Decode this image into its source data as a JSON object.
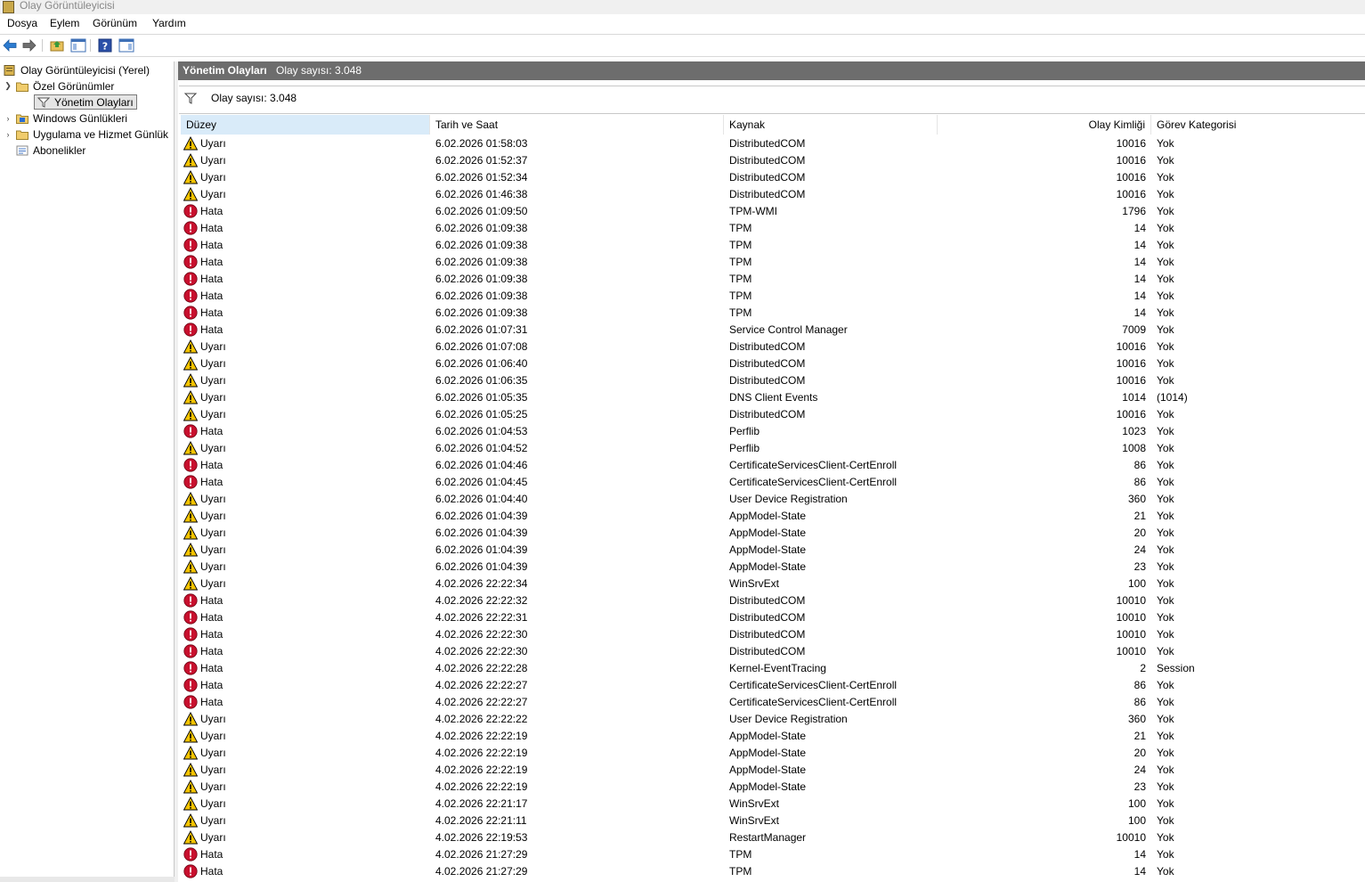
{
  "window": {
    "title": "Olay Görüntüleyicisi"
  },
  "menu": [
    "Dosya",
    "Eylem",
    "Görünüm",
    "Yardım"
  ],
  "toolbar": [
    "back-arrow-icon",
    "forward-arrow-icon",
    "open-folder-icon",
    "console-tree-icon",
    "help-icon",
    "action-pane-icon"
  ],
  "sidebar": {
    "root": "Olay Görüntüleyicisi (Yerel)",
    "custom_views": "Özel Görünümler",
    "admin_events": "Yönetim Olayları",
    "windows_logs": "Windows Günlükleri",
    "app_service_logs": "Uygulama ve Hizmet Günlük",
    "subscriptions": "Abonelikler"
  },
  "main": {
    "title": "Yönetim Olayları",
    "count_header": "Olay sayısı: 3.048",
    "filter_count": "Olay sayısı: 3.048",
    "columns": [
      "Düzey",
      "Tarih ve Saat",
      "Kaynak",
      "Olay Kimliği",
      "Görev Kategorisi"
    ]
  },
  "colors": {
    "header_bg": "#6d6d6d",
    "selected_col": "#d9ebf9",
    "warning": "#f5c400",
    "error": "#c8102e"
  },
  "events": [
    [
      "Uyarı",
      "6.02.2026 01:58:03",
      "DistributedCOM",
      "10016",
      "Yok"
    ],
    [
      "Uyarı",
      "6.02.2026 01:52:37",
      "DistributedCOM",
      "10016",
      "Yok"
    ],
    [
      "Uyarı",
      "6.02.2026 01:52:34",
      "DistributedCOM",
      "10016",
      "Yok"
    ],
    [
      "Uyarı",
      "6.02.2026 01:46:38",
      "DistributedCOM",
      "10016",
      "Yok"
    ],
    [
      "Hata",
      "6.02.2026 01:09:50",
      "TPM-WMI",
      "1796",
      "Yok"
    ],
    [
      "Hata",
      "6.02.2026 01:09:38",
      "TPM",
      "14",
      "Yok"
    ],
    [
      "Hata",
      "6.02.2026 01:09:38",
      "TPM",
      "14",
      "Yok"
    ],
    [
      "Hata",
      "6.02.2026 01:09:38",
      "TPM",
      "14",
      "Yok"
    ],
    [
      "Hata",
      "6.02.2026 01:09:38",
      "TPM",
      "14",
      "Yok"
    ],
    [
      "Hata",
      "6.02.2026 01:09:38",
      "TPM",
      "14",
      "Yok"
    ],
    [
      "Hata",
      "6.02.2026 01:09:38",
      "TPM",
      "14",
      "Yok"
    ],
    [
      "Hata",
      "6.02.2026 01:07:31",
      "Service Control Manager",
      "7009",
      "Yok"
    ],
    [
      "Uyarı",
      "6.02.2026 01:07:08",
      "DistributedCOM",
      "10016",
      "Yok"
    ],
    [
      "Uyarı",
      "6.02.2026 01:06:40",
      "DistributedCOM",
      "10016",
      "Yok"
    ],
    [
      "Uyarı",
      "6.02.2026 01:06:35",
      "DistributedCOM",
      "10016",
      "Yok"
    ],
    [
      "Uyarı",
      "6.02.2026 01:05:35",
      "DNS Client Events",
      "1014",
      "(1014)"
    ],
    [
      "Uyarı",
      "6.02.2026 01:05:25",
      "DistributedCOM",
      "10016",
      "Yok"
    ],
    [
      "Hata",
      "6.02.2026 01:04:53",
      "Perflib",
      "1023",
      "Yok"
    ],
    [
      "Uyarı",
      "6.02.2026 01:04:52",
      "Perflib",
      "1008",
      "Yok"
    ],
    [
      "Hata",
      "6.02.2026 01:04:46",
      "CertificateServicesClient-CertEnroll",
      "86",
      "Yok"
    ],
    [
      "Hata",
      "6.02.2026 01:04:45",
      "CertificateServicesClient-CertEnroll",
      "86",
      "Yok"
    ],
    [
      "Uyarı",
      "6.02.2026 01:04:40",
      "User Device Registration",
      "360",
      "Yok"
    ],
    [
      "Uyarı",
      "6.02.2026 01:04:39",
      "AppModel-State",
      "21",
      "Yok"
    ],
    [
      "Uyarı",
      "6.02.2026 01:04:39",
      "AppModel-State",
      "20",
      "Yok"
    ],
    [
      "Uyarı",
      "6.02.2026 01:04:39",
      "AppModel-State",
      "24",
      "Yok"
    ],
    [
      "Uyarı",
      "6.02.2026 01:04:39",
      "AppModel-State",
      "23",
      "Yok"
    ],
    [
      "Uyarı",
      "4.02.2026 22:22:34",
      "WinSrvExt",
      "100",
      "Yok"
    ],
    [
      "Hata",
      "4.02.2026 22:22:32",
      "DistributedCOM",
      "10010",
      "Yok"
    ],
    [
      "Hata",
      "4.02.2026 22:22:31",
      "DistributedCOM",
      "10010",
      "Yok"
    ],
    [
      "Hata",
      "4.02.2026 22:22:30",
      "DistributedCOM",
      "10010",
      "Yok"
    ],
    [
      "Hata",
      "4.02.2026 22:22:30",
      "DistributedCOM",
      "10010",
      "Yok"
    ],
    [
      "Hata",
      "4.02.2026 22:22:28",
      "Kernel-EventTracing",
      "2",
      "Session"
    ],
    [
      "Hata",
      "4.02.2026 22:22:27",
      "CertificateServicesClient-CertEnroll",
      "86",
      "Yok"
    ],
    [
      "Hata",
      "4.02.2026 22:22:27",
      "CertificateServicesClient-CertEnroll",
      "86",
      "Yok"
    ],
    [
      "Uyarı",
      "4.02.2026 22:22:22",
      "User Device Registration",
      "360",
      "Yok"
    ],
    [
      "Uyarı",
      "4.02.2026 22:22:19",
      "AppModel-State",
      "21",
      "Yok"
    ],
    [
      "Uyarı",
      "4.02.2026 22:22:19",
      "AppModel-State",
      "20",
      "Yok"
    ],
    [
      "Uyarı",
      "4.02.2026 22:22:19",
      "AppModel-State",
      "24",
      "Yok"
    ],
    [
      "Uyarı",
      "4.02.2026 22:22:19",
      "AppModel-State",
      "23",
      "Yok"
    ],
    [
      "Uyarı",
      "4.02.2026 22:21:17",
      "WinSrvExt",
      "100",
      "Yok"
    ],
    [
      "Uyarı",
      "4.02.2026 22:21:11",
      "WinSrvExt",
      "100",
      "Yok"
    ],
    [
      "Uyarı",
      "4.02.2026 22:19:53",
      "RestartManager",
      "10010",
      "Yok"
    ],
    [
      "Hata",
      "4.02.2026 21:27:29",
      "TPM",
      "14",
      "Yok"
    ],
    [
      "Hata",
      "4.02.2026 21:27:29",
      "TPM",
      "14",
      "Yok"
    ]
  ]
}
